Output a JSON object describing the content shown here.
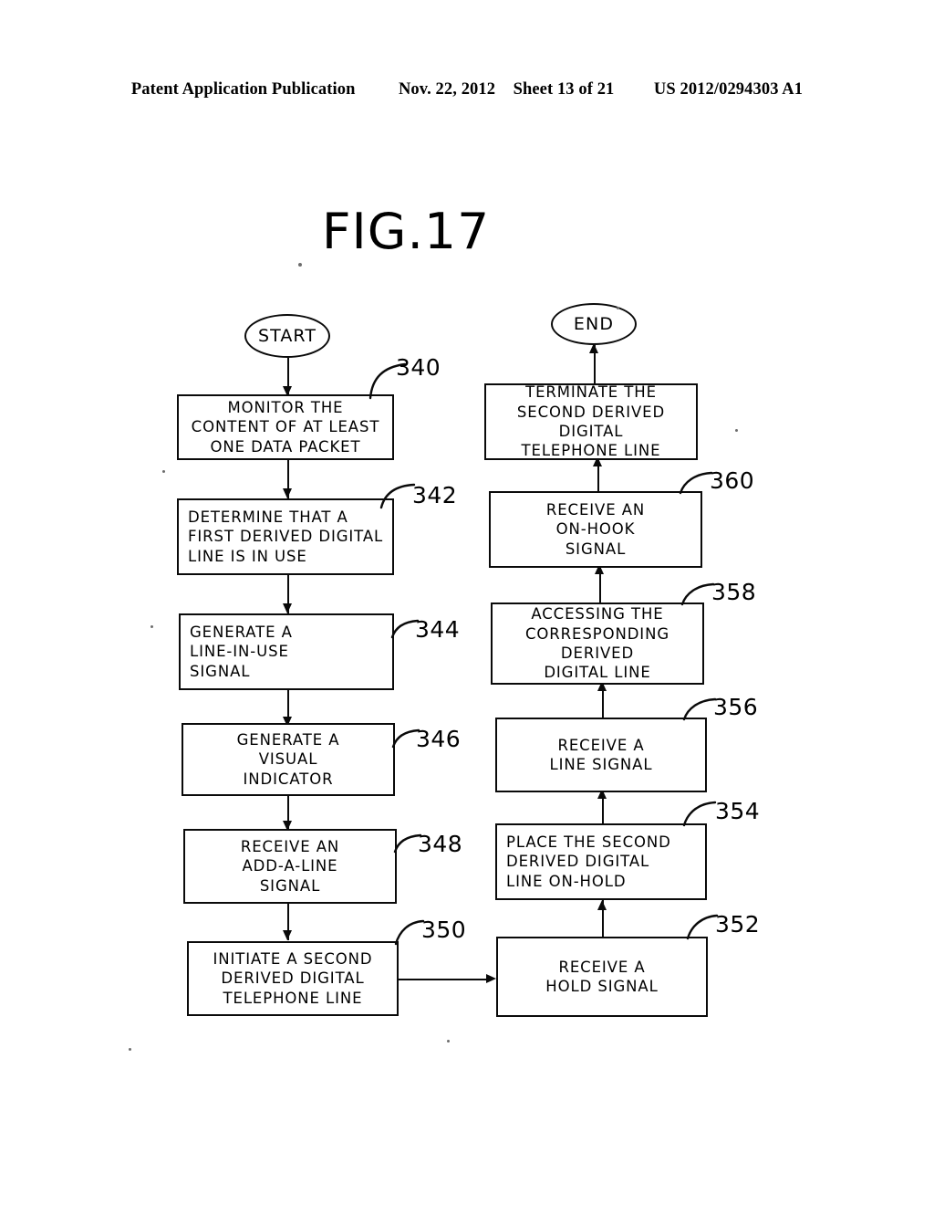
{
  "header": {
    "publication": "Patent Application Publication",
    "date": "Nov. 22, 2012",
    "sheet": "Sheet 13 of 21",
    "patent_number": "US 2012/0294303 A1"
  },
  "figure": {
    "title": "FIG.17"
  },
  "terminators": {
    "start": "START",
    "end": "END"
  },
  "left_column": {
    "boxes": [
      {
        "ref": "340",
        "lines": [
          "MONITOR   THE",
          "CONTENT OF AT LEAST",
          "ONE DATA  PACKET"
        ]
      },
      {
        "ref": "342",
        "lines": [
          "DETERMINE  THAT  A",
          "FIRST DERIVED DIGITAL",
          "LINE IS IN USE"
        ]
      },
      {
        "ref": "344",
        "lines": [
          "GENERATE   A",
          "LINE-IN-USE",
          "SIGNAL"
        ]
      },
      {
        "ref": "346",
        "lines": [
          "GENERATE  A",
          "VISUAL",
          "INDICATOR"
        ]
      },
      {
        "ref": "348",
        "lines": [
          "RECEIVE  AN",
          "ADD-A-LINE",
          "SIGNAL"
        ]
      },
      {
        "ref": "350",
        "lines": [
          "INITIATE A SECOND",
          "DERIVED  DIGITAL",
          "TELEPHONE  LINE"
        ]
      }
    ]
  },
  "right_column": {
    "boxes": [
      {
        "ref": "",
        "lines": [
          "TERMINATE   THE",
          "SECOND  DERIVED",
          "DIGITAL",
          "TELEPHONE  LINE"
        ]
      },
      {
        "ref": "360",
        "lines": [
          "RECEIVE AN",
          "ON-HOOK",
          "SIGNAL"
        ]
      },
      {
        "ref": "358",
        "lines": [
          "ACCESSING   THE",
          "CORRESPONDING",
          "DERIVED",
          "DIGITAL LINE"
        ]
      },
      {
        "ref": "356",
        "lines": [
          "RECEIVE A",
          "LINE SIGNAL"
        ]
      },
      {
        "ref": "354",
        "lines": [
          "PLACE THE SECOND",
          "DERIVED  DIGITAL",
          "LINE ON-HOLD"
        ]
      },
      {
        "ref": "352",
        "lines": [
          "RECEIVE  A",
          "HOLD SIGNAL"
        ]
      }
    ]
  },
  "colors": {
    "ink": "#0a0a0a",
    "paper": "#ffffff"
  }
}
